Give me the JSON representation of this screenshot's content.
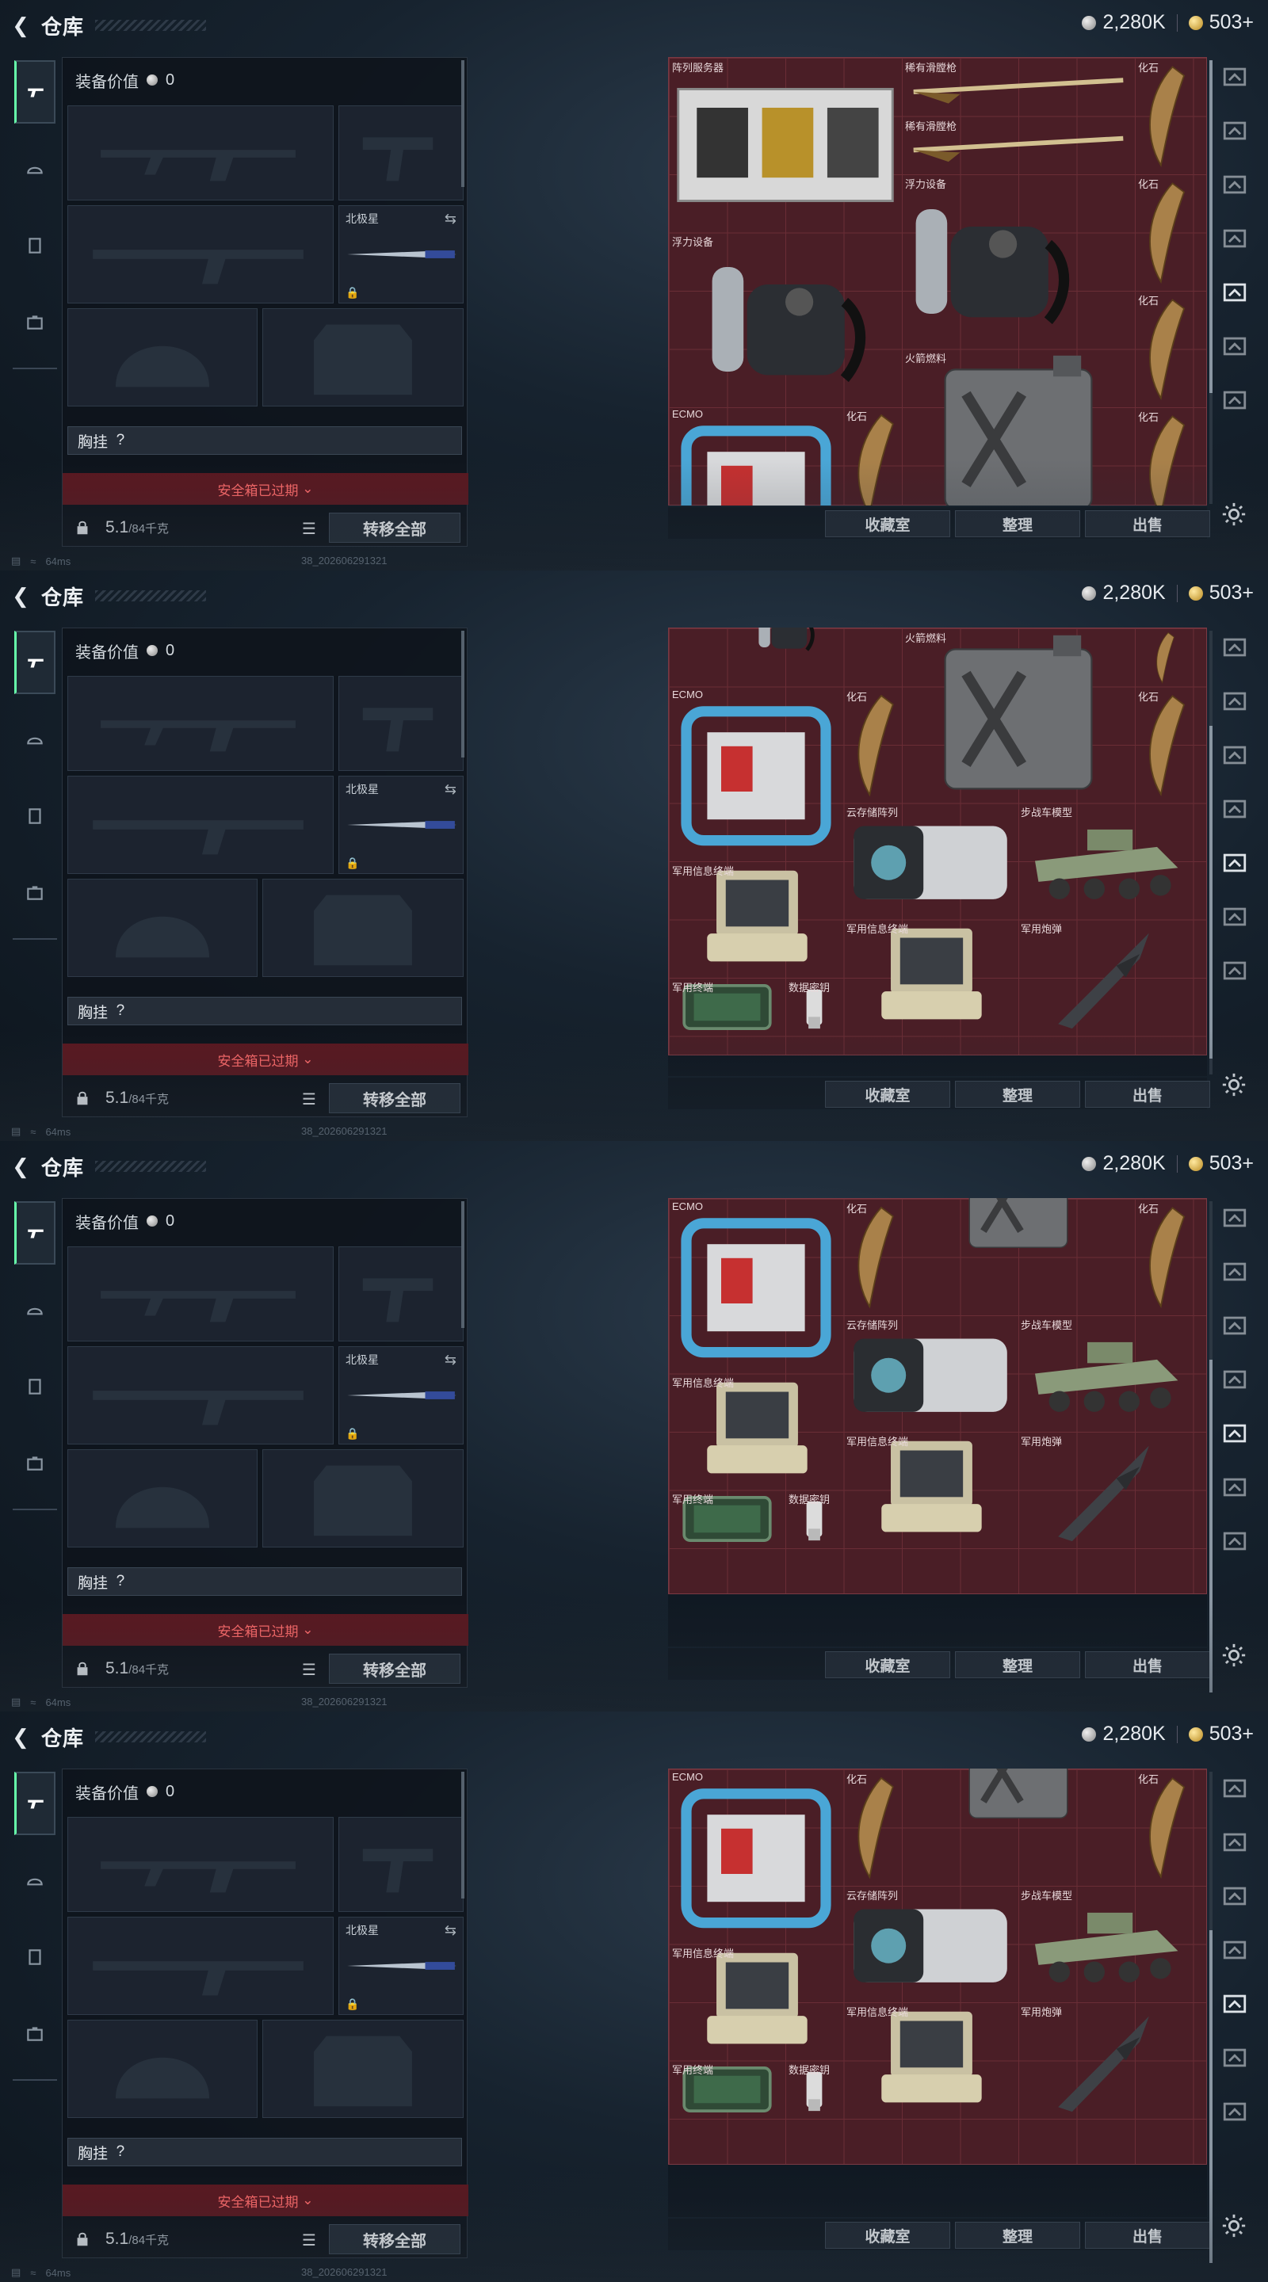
{
  "header": {
    "title": "仓库",
    "silver": "2,280K",
    "gold": "503+"
  },
  "equipment": {
    "value_label": "装备价值",
    "value": "0",
    "melee_label": "北极星",
    "chest_rig_label": "胸挂",
    "chest_rig_value": "?",
    "safe_box_banner": "安全箱已过期",
    "weight_current": "5.1",
    "weight_max": "/84千克",
    "transfer_all": "转移全部"
  },
  "storage_buttons": {
    "collection": "收藏室",
    "organize": "整理",
    "sell": "出售"
  },
  "status": {
    "ping": "64ms",
    "build": "38_202606291321"
  },
  "item_names": {
    "server": "阵列服务器",
    "musket": "稀有滑膛枪",
    "fossil": "化石",
    "diving": "浮力设备",
    "fuel": "火箭燃料",
    "ecmo": "ECMO",
    "cloud": "云存储阵列",
    "ifv": "步战车模型",
    "terminal": "军用信息终端",
    "shell": "军用炮弹",
    "mil_terminal": "军用终端",
    "datakey": "数据密钥"
  },
  "icons": [
    "back-icon",
    "silver-coin-icon",
    "gold-coin-icon",
    "gun-icon",
    "helmet-icon",
    "armor-icon",
    "backpack-icon",
    "lock-icon",
    "list-icon",
    "gear-icon"
  ],
  "colors": {
    "grid_bg": "#4a1e26",
    "banner_bg": "#5a1820",
    "banner_text": "#ff6a6a"
  }
}
